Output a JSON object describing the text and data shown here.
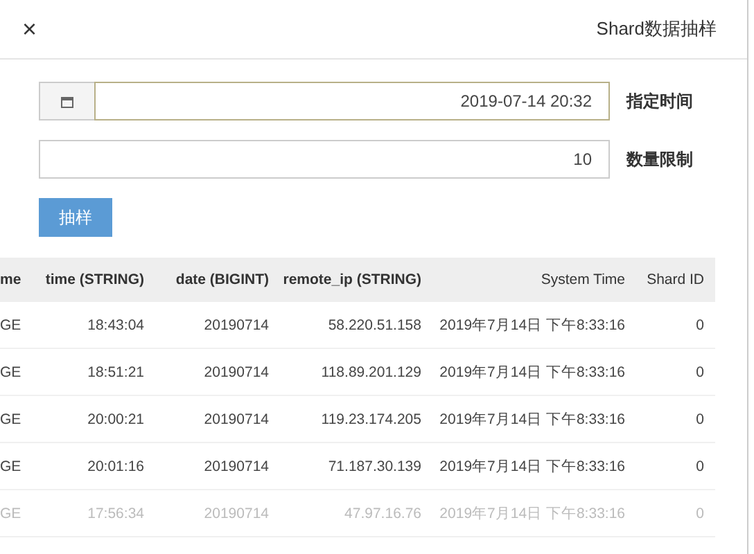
{
  "dialog": {
    "title": "Shard数据抽样",
    "close": "×"
  },
  "form": [
    {
      "kind": "date",
      "label": "指定时间",
      "value": "2019-07-14 20:32"
    },
    {
      "kind": "number",
      "label": "数量限制",
      "value": "10"
    }
  ],
  "submit": "抽样",
  "table": {
    "columns": [
      "me",
      "time (STRING)",
      "date (BIGINT)",
      "remote_ip (STRING)",
      "System Time",
      "Shard ID"
    ],
    "rows": [
      {
        "faded": false,
        "cells": [
          "GE",
          "18:43:04",
          "20190714",
          "58.220.51.158",
          "2019年7月14日 下午8:33:16",
          "0"
        ]
      },
      {
        "faded": false,
        "cells": [
          "GE",
          "18:51:21",
          "20190714",
          "118.89.201.129",
          "2019年7月14日 下午8:33:16",
          "0"
        ]
      },
      {
        "faded": false,
        "cells": [
          "GE",
          "20:00:21",
          "20190714",
          "119.23.174.205",
          "2019年7月14日 下午8:33:16",
          "0"
        ]
      },
      {
        "faded": false,
        "cells": [
          "GE",
          "20:01:16",
          "20190714",
          "71.187.30.139",
          "2019年7月14日 下午8:33:16",
          "0"
        ]
      },
      {
        "faded": true,
        "cells": [
          "GE",
          "17:56:34",
          "20190714",
          "47.97.16.76",
          "2019年7月14日 下午8:33:16",
          "0"
        ]
      }
    ]
  }
}
